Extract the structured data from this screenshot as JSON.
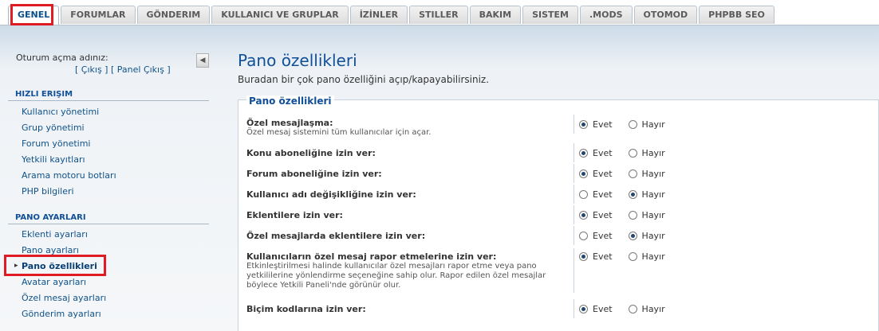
{
  "tabs": [
    {
      "label": "GENEL",
      "active": true
    },
    {
      "label": "FORUMLAR"
    },
    {
      "label": "GÖNDERIM"
    },
    {
      "label": "KULLANICI VE GRUPLAR"
    },
    {
      "label": "İZİNLER"
    },
    {
      "label": "STILLER"
    },
    {
      "label": "BAKIM"
    },
    {
      "label": "SISTEM"
    },
    {
      "label": ".MODS"
    },
    {
      "label": "OTOMOD"
    },
    {
      "label": "PHPBB SEO"
    }
  ],
  "sidebar": {
    "login_label": "Oturum açma adınız:",
    "logout_link": "[ Çıkış ]",
    "panel_logout_link": "[ Panel Çıkış ]",
    "collapse_icon": "◀",
    "quick_access": {
      "header": "HIZLI ERIŞIM",
      "items": [
        "Kullanıcı yönetimi",
        "Grup yönetimi",
        "Forum yönetimi",
        "Yetkili kayıtları",
        "Arama motoru botları",
        "PHP bilgileri"
      ]
    },
    "board_settings": {
      "header": "PANO AYARLARI",
      "items": [
        "Eklenti ayarları",
        "Pano ayarları",
        "Pano özellikleri",
        "Avatar ayarları",
        "Özel mesaj ayarları",
        "Gönderim ayarları"
      ],
      "active_index": 2
    }
  },
  "main": {
    "title": "Pano özellikleri",
    "description": "Buradan bir çok pano özelliğini açıp/kapayabilirsiniz.",
    "fieldset_legend": "Pano özellikleri",
    "yes_label": "Evet",
    "no_label": "Hayır",
    "rows": [
      {
        "label": "Özel mesajlaşma:",
        "desc": "Özel mesaj sistemini tüm kullanıcılar için açar.",
        "value": "yes"
      },
      {
        "label": "Konu aboneliğine izin ver:",
        "desc": "",
        "value": "yes"
      },
      {
        "label": "Forum aboneliğine izin ver:",
        "desc": "",
        "value": "yes"
      },
      {
        "label": "Kullanıcı adı değişikliğine izin ver:",
        "desc": "",
        "value": "no"
      },
      {
        "label": "Eklentilere izin ver:",
        "desc": "",
        "value": "yes"
      },
      {
        "label": "Özel mesajlarda eklentilere izin ver:",
        "desc": "",
        "value": "no"
      },
      {
        "label": "Kullanıcıların özel mesaj rapor etmelerine izin ver:",
        "desc": "Etkinleştirilmesi halinde kullanıcılar özel mesajları rapor etme veya pano yetkililerine yönlendirme seçeneğine sahip olur. Rapor edilen özel mesajlar böylece Yetkili Paneli'nde görünür olur.",
        "value": "yes"
      },
      {
        "label": "Biçim kodlarına izin ver:",
        "desc": "",
        "value": "yes"
      }
    ]
  },
  "colors": {
    "highlight": "#e01b24",
    "accent": "#115098"
  }
}
